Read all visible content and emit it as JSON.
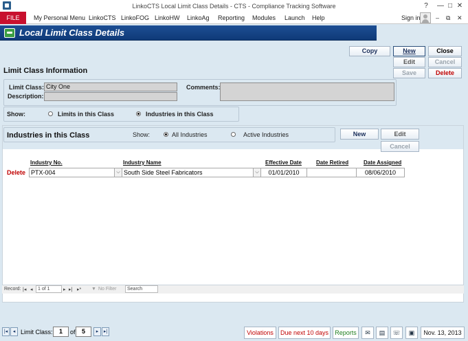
{
  "window": {
    "title": "LinkoCTS Local Limit Class Details - CTS - Compliance Tracking Software",
    "help": "?",
    "minimize": "—",
    "restore": "□",
    "close": "✕"
  },
  "menubar": {
    "file": "FILE",
    "items": [
      "My Personal Menu",
      "LinkoCTS",
      "LinkoFOG",
      "LinkoHW",
      "LinkoAg",
      "Reporting",
      "Modules",
      "Launch",
      "Help"
    ],
    "signin": "Sign in",
    "doc_minimize": "–",
    "doc_restore": "⧉",
    "doc_close": "✕"
  },
  "form": {
    "title": "Local Limit Class Details",
    "buttons": {
      "copy": "Copy",
      "new": "New",
      "close": "Close",
      "edit": "Edit",
      "cancel": "Cancel",
      "save": "Save",
      "delete": "Delete"
    },
    "section_title": "Limit Class Information",
    "limit_class_label": "Limit Class:",
    "limit_class_value": "City One",
    "description_label": "Description:",
    "description_value": "",
    "comments_label": "Comments:",
    "comments_value": "",
    "show_label": "Show:",
    "show_options": [
      "Limits in this Class",
      "Industries in this Class"
    ],
    "show_selected": "Industries in this Class"
  },
  "subform": {
    "title": "Industries in this Class",
    "show_label": "Show:",
    "filter_options": [
      "All Industries",
      "Active Industries"
    ],
    "filter_selected": "All Industries",
    "buttons": {
      "new": "New",
      "edit": "Edit",
      "cancel": "Cancel"
    },
    "columns": [
      "Industry No.",
      "Industry Name",
      "Effective Date",
      "Date Retired",
      "Date Assigned"
    ],
    "rows": [
      {
        "delete": "Delete",
        "industry_no": "PTX-004",
        "industry_name": "South Side Steel Fabricators",
        "effective_date": "01/01/2010",
        "date_retired": "",
        "date_assigned": "08/06/2010"
      }
    ],
    "record_nav": {
      "label": "Record:",
      "position": "1 of 1",
      "filter": "No Filter",
      "search": "Search"
    }
  },
  "bottombar": {
    "limit_class_label": "Limit Class:",
    "current": "1",
    "of_label": "of",
    "total": "5",
    "violations": "Violations",
    "due_next": "Due next 10 days",
    "reports": "Reports",
    "date": "Nov. 13, 2013",
    "colors": {
      "violations": "#c00000",
      "due_next": "#c00000",
      "reports": "#1e7d1e"
    }
  }
}
